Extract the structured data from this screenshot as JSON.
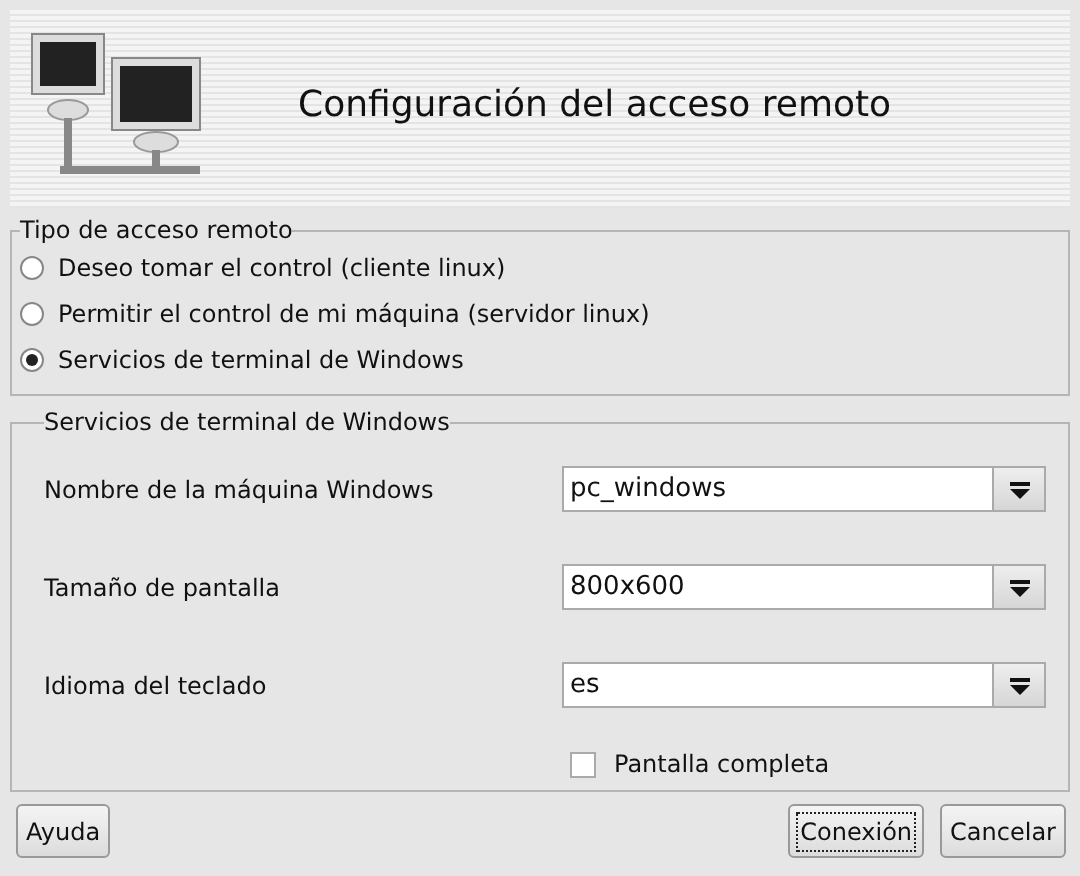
{
  "header": {
    "title": "Configuración del acceso remoto"
  },
  "access_type": {
    "legend": "Tipo de acceso remoto",
    "options": [
      {
        "label": "Deseo tomar el control (cliente linux)",
        "selected": false
      },
      {
        "label": "Permitir el control de mi máquina (servidor linux)",
        "selected": false
      },
      {
        "label": "Servicios de terminal de Windows",
        "selected": true
      }
    ]
  },
  "terminal_services": {
    "legend": "Servicios de terminal de Windows",
    "fields": [
      {
        "label": "Nombre de la máquina Windows",
        "value": "pc_windows"
      },
      {
        "label": "Tamaño de pantalla",
        "value": "800x600"
      },
      {
        "label": "Idioma del teclado",
        "value": "es"
      }
    ],
    "fullscreen": {
      "label": "Pantalla completa",
      "checked": false
    }
  },
  "buttons_left": [
    {
      "label": "Ayuda",
      "focused": false
    }
  ],
  "buttons_right": [
    {
      "label": "Conexión",
      "focused": true
    },
    {
      "label": "Cancelar",
      "focused": false
    }
  ]
}
